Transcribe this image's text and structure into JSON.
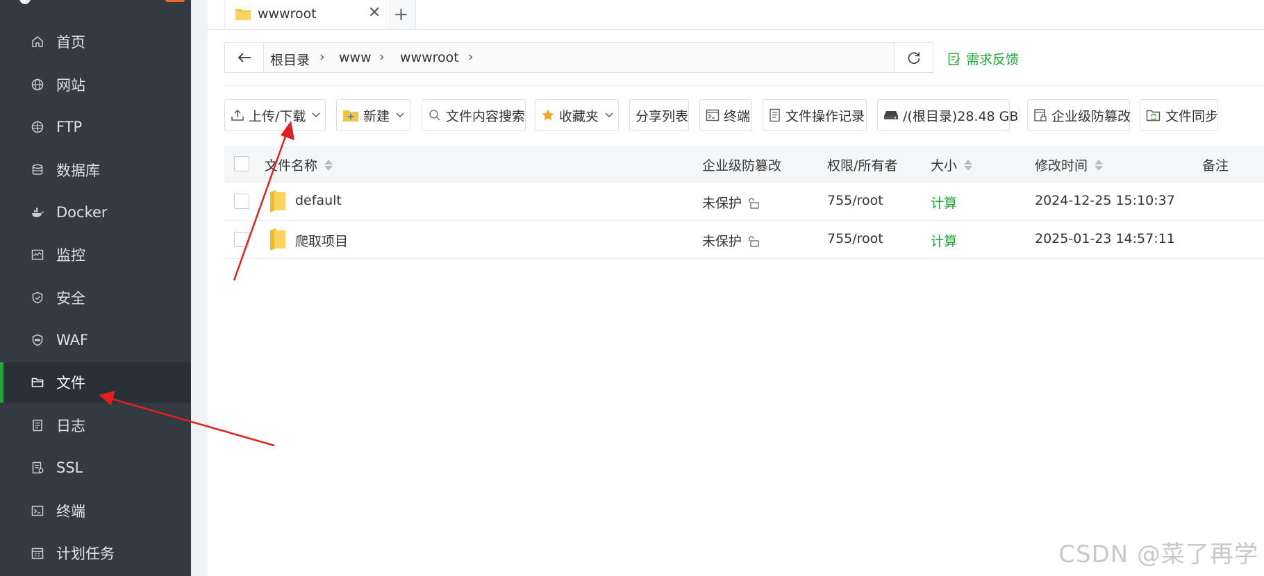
{
  "sidebar": {
    "items": [
      {
        "label": "首页",
        "icon": "home-icon"
      },
      {
        "label": "网站",
        "icon": "globe-icon"
      },
      {
        "label": "FTP",
        "icon": "globe-ftp-icon"
      },
      {
        "label": "数据库",
        "icon": "database-icon"
      },
      {
        "label": "Docker",
        "icon": "docker-icon"
      },
      {
        "label": "监控",
        "icon": "monitor-icon"
      },
      {
        "label": "安全",
        "icon": "shield-icon"
      },
      {
        "label": "WAF",
        "icon": "waf-shield-icon"
      },
      {
        "label": "文件",
        "icon": "folder-icon",
        "active": true
      },
      {
        "label": "日志",
        "icon": "log-icon"
      },
      {
        "label": "SSL",
        "icon": "ssl-icon"
      },
      {
        "label": "终端",
        "icon": "terminal-icon"
      },
      {
        "label": "计划任务",
        "icon": "calendar-icon"
      }
    ],
    "accent_color": "#20a53a"
  },
  "tabs": {
    "active_tab": "wwwroot",
    "close_symbol": "✕",
    "add_symbol": "+"
  },
  "pathbar": {
    "crumbs": [
      "根目录",
      "www",
      "wwwroot"
    ],
    "separator": "›"
  },
  "feedback": {
    "label": "需求反馈"
  },
  "toolbar": {
    "upload_download": "上传/下载",
    "new": "新建",
    "content_search": "文件内容搜索",
    "favorites": "收藏夹",
    "share_list": "分享列表",
    "terminal": "终端",
    "file_op_log": "文件操作记录",
    "disk": "/(根目录)28.48 GB",
    "tamper_proof": "企业级防篡改",
    "file_sync": "文件同步"
  },
  "table": {
    "headers": {
      "name": "文件名称",
      "tamper": "企业级防篡改",
      "perm": "权限/所有者",
      "size": "大小",
      "mtime": "修改时间",
      "note": "备注"
    },
    "rows": [
      {
        "name": "default",
        "tamper": "未保护",
        "perm": "755/root",
        "size": "计算",
        "mtime": "2024-12-25 15:10:37"
      },
      {
        "name": "爬取项目",
        "tamper": "未保护",
        "perm": "755/root",
        "size": "计算",
        "mtime": "2025-01-23 14:57:11"
      }
    ]
  },
  "watermark": "CSDN @菜了再学",
  "colors": {
    "sidebar_bg": "#333a42",
    "accent_green": "#20a53a",
    "folder_yellow": "#f5c342",
    "arrow_red": "#e02020"
  }
}
